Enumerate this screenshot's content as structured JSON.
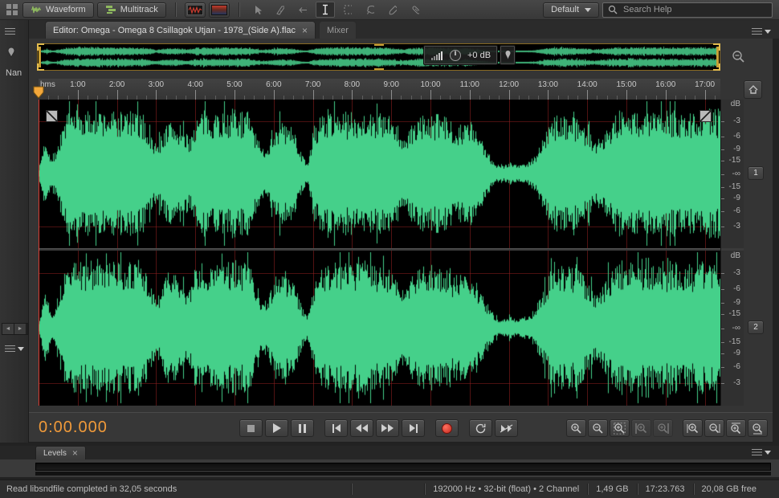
{
  "toolbar": {
    "waveform_label": "Waveform",
    "multitrack_label": "Multitrack",
    "workspace_label": "Default",
    "search_placeholder": "Search Help"
  },
  "tabs": {
    "editor_label": "Editor: Omega - Omega 8 Csillagok Utjan - 1978_(Side A).flac",
    "mixer_label": "Mixer",
    "close_glyph": "×"
  },
  "overview": {
    "gain_label": "+0 dB"
  },
  "left_panel": {
    "name_label": "Nan"
  },
  "timeline": {
    "unit_label": "hms",
    "minute_labels": [
      "1:00",
      "2:00",
      "3:00",
      "4:00",
      "5:00",
      "6:00",
      "7:00",
      "8:00",
      "9:00",
      "10:00",
      "11:00",
      "12:00",
      "13:00",
      "14:00",
      "15:00",
      "16:00",
      "17:00"
    ]
  },
  "scale": {
    "labels": [
      {
        "text": "dB",
        "pct": 3.5,
        "tick": false
      },
      {
        "text": "-3",
        "pct": 14.5,
        "tick": true
      },
      {
        "text": "-6",
        "pct": 25,
        "tick": true
      },
      {
        "text": "-9",
        "pct": 33.5,
        "tick": true
      },
      {
        "text": "-15",
        "pct": 41,
        "tick": true
      },
      {
        "text": "-∞",
        "pct": 50,
        "tick": true
      },
      {
        "text": "-15",
        "pct": 59,
        "tick": true
      },
      {
        "text": "-9",
        "pct": 66.5,
        "tick": true
      },
      {
        "text": "-6",
        "pct": 75,
        "tick": true
      },
      {
        "text": "-3",
        "pct": 85.5,
        "tick": true
      }
    ]
  },
  "channels": [
    {
      "label": "1"
    },
    {
      "label": "2"
    }
  ],
  "transport": {
    "time_display": "0:00.000"
  },
  "levels": {
    "tab_label": "Levels",
    "close_glyph": "×"
  },
  "status": {
    "message": "Read libsndfile completed in 32,05 seconds",
    "format": "192000 Hz • 32-bit (float) • 2 Channel",
    "size": "1,49 GB",
    "duration": "17:23.763",
    "free_space": "20,08 GB free"
  },
  "waveform": {
    "color": "#45d08a",
    "overview_color": "#3fb278",
    "envelope": [
      0.06,
      0.55,
      0.18,
      0.45,
      0.8,
      0.88,
      0.9,
      0.86,
      0.9,
      0.92,
      0.87,
      0.9,
      0.86,
      0.9,
      0.88,
      0.84,
      0.82,
      0.55,
      0.38,
      0.62,
      0.75,
      0.7,
      0.58,
      0.52,
      0.78,
      0.88,
      0.86,
      0.9,
      0.85,
      0.89,
      0.91,
      0.87,
      0.88,
      0.6,
      0.35,
      0.42,
      0.65,
      0.72,
      0.7,
      0.62,
      0.3,
      0.14,
      0.55,
      0.82,
      0.9,
      0.87,
      0.9,
      0.85,
      0.88,
      0.86,
      0.9,
      0.84,
      0.87,
      0.8,
      0.74,
      0.6,
      0.5,
      0.68,
      0.8,
      0.85,
      0.8,
      0.84,
      0.79,
      0.74,
      0.7,
      0.74,
      0.7,
      0.58,
      0.4,
      0.24,
      0.13,
      0.12,
      0.16,
      0.12,
      0.14,
      0.18,
      0.3,
      0.5,
      0.72,
      0.8,
      0.85,
      0.84,
      0.8,
      0.74,
      0.58,
      0.45,
      0.55,
      0.7,
      0.84,
      0.9,
      0.87,
      0.9,
      0.85,
      0.89,
      0.87,
      0.9,
      0.85,
      0.9,
      0.87,
      0.9,
      0.84,
      0.89,
      0.91,
      0.9,
      0.88
    ]
  }
}
